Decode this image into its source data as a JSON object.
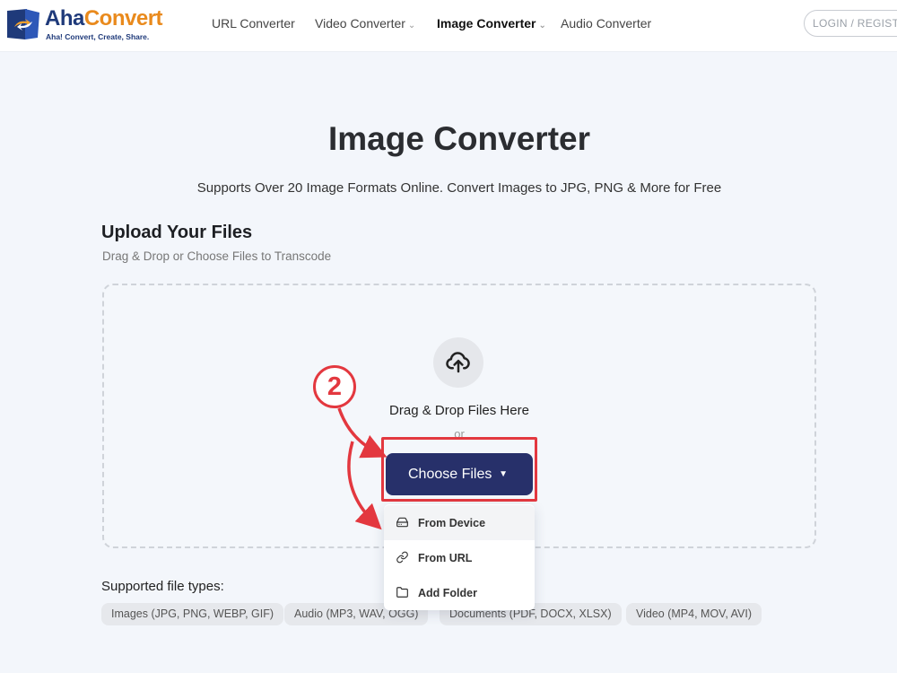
{
  "header": {
    "logo": {
      "name_part1": "Aha",
      "name_part2": "Convert",
      "tagline": "Aha! Convert, Create, Share."
    },
    "nav": [
      {
        "label": "URL Converter",
        "has_dropdown": false
      },
      {
        "label": "Video Converter",
        "has_dropdown": true
      },
      {
        "label": "Image Converter",
        "has_dropdown": true,
        "active": true
      },
      {
        "label": "Audio Converter",
        "has_dropdown": false
      }
    ],
    "login_label": "LOGIN / REGISTER"
  },
  "main": {
    "title": "Image Converter",
    "subtitle": "Supports Over 20 Image Formats Online. Convert Images to JPG, PNG & More for Free",
    "upload_title": "Upload Your Files",
    "upload_subtitle": "Drag & Drop or Choose Files to Transcode",
    "dropzone": {
      "icon": "cloud-upload-icon",
      "drag_text": "Drag & Drop Files Here",
      "or_text": "or",
      "choose_button": "Choose Files",
      "caret": "▼"
    },
    "menu": [
      {
        "label": "From Device",
        "icon": "hard-drive-icon"
      },
      {
        "label": "From URL",
        "icon": "link-icon"
      },
      {
        "label": "Add Folder",
        "icon": "folder-icon"
      }
    ],
    "supported_label": "Supported file types:",
    "file_types": [
      "Images (JPG, PNG, WEBP, GIF)",
      "Audio (MP3, WAV, OGG)",
      "Documents (PDF, DOCX, XLSX)",
      "Video (MP4, MOV, AVI)"
    ]
  },
  "annotation": {
    "step_number": "2",
    "color": "#e3383f"
  },
  "colors": {
    "primary_button": "#27306a",
    "brand_blue": "#1f3a7a",
    "brand_orange": "#e98a1d"
  }
}
